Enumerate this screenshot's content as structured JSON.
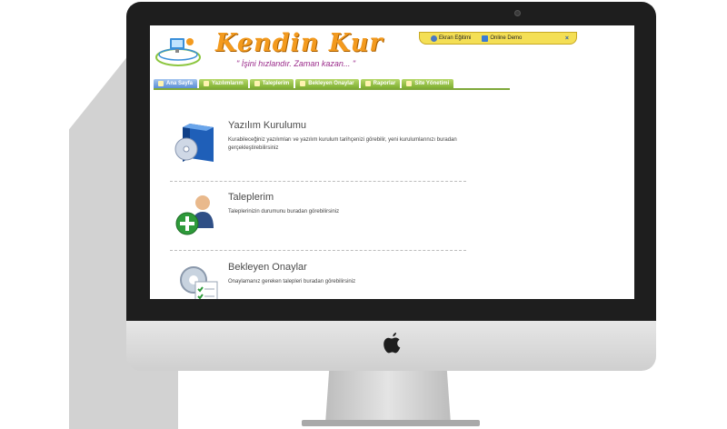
{
  "app": {
    "brand": "Kendin Kur",
    "slogan": "\" İşini hızlandır. Zaman kazan... \""
  },
  "helpbar": {
    "items": [
      {
        "label": "Ekran Eğitimi",
        "icon": "help-icon"
      },
      {
        "label": "Online Demo",
        "icon": "monitor-icon"
      }
    ],
    "close": "×"
  },
  "nav": {
    "tabs": [
      {
        "label": "Ana Sayfa",
        "icon": "home-icon",
        "active": true
      },
      {
        "label": "Yazılımlarım",
        "icon": "software-icon"
      },
      {
        "label": "Taleplerim",
        "icon": "request-icon"
      },
      {
        "label": "Bekleyen Onaylar",
        "icon": "check-icon"
      },
      {
        "label": "Raporlar",
        "icon": "report-icon"
      },
      {
        "label": "Site Yönetimi",
        "icon": "admin-icon"
      }
    ]
  },
  "items": [
    {
      "title": "Yazılım Kurulumu",
      "desc": "Kurabileceğiniz yazılımları ve yazılım kurulum tarihçenizi görebilir, yeni kurulumlarınızı buradan gerçekleştirebilirsiniz",
      "icon": "software-box-icon"
    },
    {
      "title": "Taleplerim",
      "desc": "Taleplerinizin durumunu buradan görebilirsiniz",
      "icon": "user-add-icon"
    },
    {
      "title": "Bekleyen Onaylar",
      "desc": "Onaylamanız gereken talepleri buradan görebilirsiniz",
      "icon": "approval-gear-icon"
    }
  ],
  "colors": {
    "brand_orange": "#f39a1e",
    "tab_green": "#8dbb3c",
    "tab_active_blue": "#5a8fd6",
    "helpbar_yellow": "#f4df55"
  }
}
